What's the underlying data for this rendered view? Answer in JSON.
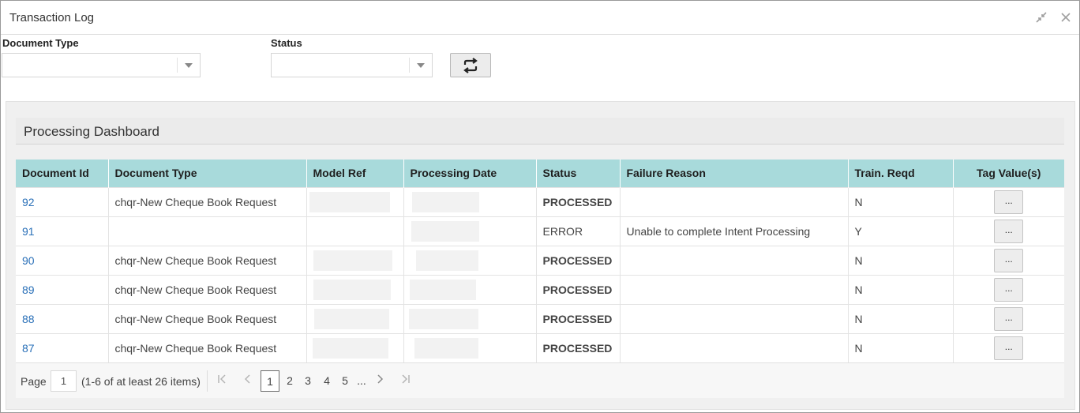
{
  "window": {
    "title": "Transaction Log"
  },
  "filters": {
    "document_type": {
      "label": "Document Type",
      "value": ""
    },
    "status": {
      "label": "Status",
      "value": ""
    }
  },
  "dashboard": {
    "title": "Processing Dashboard",
    "columns": [
      "Document Id",
      "Document Type",
      "Model Ref",
      "Processing Date",
      "Status",
      "Failure Reason",
      "Train. Reqd",
      "Tag Value(s)"
    ],
    "rows": [
      {
        "id": "92",
        "doc_type": "chqr-New Cheque Book Request",
        "status": "PROCESSED",
        "failure_reason": "",
        "train_reqd": "N",
        "tag": "..."
      },
      {
        "id": "91",
        "doc_type": "",
        "status": "ERROR",
        "failure_reason": "Unable to complete Intent Processing",
        "train_reqd": "Y",
        "tag": "..."
      },
      {
        "id": "90",
        "doc_type": "chqr-New Cheque Book Request",
        "status": "PROCESSED",
        "failure_reason": "",
        "train_reqd": "N",
        "tag": "..."
      },
      {
        "id": "89",
        "doc_type": "chqr-New Cheque Book Request",
        "status": "PROCESSED",
        "failure_reason": "",
        "train_reqd": "N",
        "tag": "..."
      },
      {
        "id": "88",
        "doc_type": "chqr-New Cheque Book Request",
        "status": "PROCESSED",
        "failure_reason": "",
        "train_reqd": "N",
        "tag": "..."
      },
      {
        "id": "87",
        "doc_type": "chqr-New Cheque Book Request",
        "status": "PROCESSED",
        "failure_reason": "",
        "train_reqd": "N",
        "tag": "..."
      }
    ]
  },
  "pager": {
    "page_label": "Page",
    "page_value": "1",
    "summary": "(1-6 of at least 26 items)",
    "pages": [
      "1",
      "2",
      "3",
      "4",
      "5",
      "..."
    ],
    "active_page": "1"
  },
  "colors": {
    "header_bg": "#a8dadb",
    "processed": "#1e8a2e",
    "error": "#e0201d",
    "link": "#2a70b8"
  },
  "icons": {
    "minimize": "minimize-icon",
    "close": "close-icon",
    "refresh": "refresh-icon",
    "first": "first-page-icon",
    "prev": "prev-page-icon",
    "next": "next-page-icon",
    "last": "last-page-icon"
  }
}
